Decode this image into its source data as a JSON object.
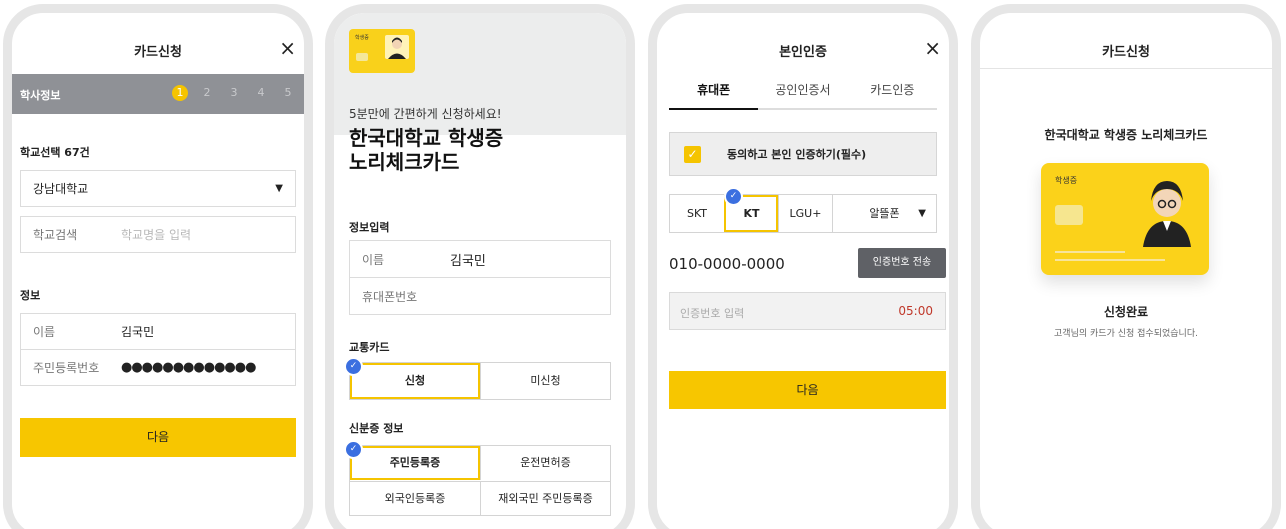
{
  "screen1": {
    "title": "카드신청",
    "close_icon": "×",
    "stepbar_label": "학사정보",
    "steps": [
      "1",
      "2",
      "3",
      "4",
      "5"
    ],
    "school_section": "학교선택 67건",
    "school_select_value": "강남대학교",
    "school_search_label": "학교검색",
    "school_search_placeholder": "학교명을 입력",
    "info_section": "정보",
    "name_label": "이름",
    "name_value": "김국민",
    "rrn_label": "주민등록번호",
    "rrn_value": "●●●●●●●●●●●●●",
    "next_button": "다음"
  },
  "screen2": {
    "card_label": "학생증",
    "subtitle": "5분만에 간편하게 신청하세요!",
    "headline_line1": "한국대학교 학생증",
    "headline_line2": "노리체크카드",
    "info_section": "정보입력",
    "name_label": "이름",
    "name_value": "김국민",
    "phone_label": "휴대폰번호",
    "transit_section": "교통카드",
    "transit_options": [
      "신청",
      "미신청"
    ],
    "id_section": "신분증 정보",
    "id_options": [
      "주민등록증",
      "운전면허증",
      "외국인등록증",
      "재외국민 주민등록증"
    ]
  },
  "screen3": {
    "title": "본인인증",
    "close_icon": "×",
    "tabs": [
      "휴대폰",
      "공인인증서",
      "카드인증"
    ],
    "agree_text": "동의하고 본인 인증하기(필수)",
    "carriers": [
      "SKT",
      "KT",
      "LGU+",
      "알뜰폰"
    ],
    "phone_number": "010-0000-0000",
    "send_button": "인증번호 전송",
    "code_placeholder": "인증번호 입력",
    "timer": "05:00",
    "next_button": "다음"
  },
  "screen4": {
    "title": "카드신청",
    "card_title": "한국대학교 학생증 노리체크카드",
    "card_label": "학생증",
    "done_title": "신청완료",
    "done_sub": "고객님의 카드가 신청 접수되었습니다."
  },
  "colors": {
    "accent": "#f7c600",
    "stepbar": "#8f9196",
    "check": "#3b6fe0",
    "timer": "#c0392b"
  },
  "icons": {
    "close": "close-icon",
    "dropdown": "chevron-down-icon",
    "check": "check-icon",
    "avatar": "avatar-icon"
  }
}
